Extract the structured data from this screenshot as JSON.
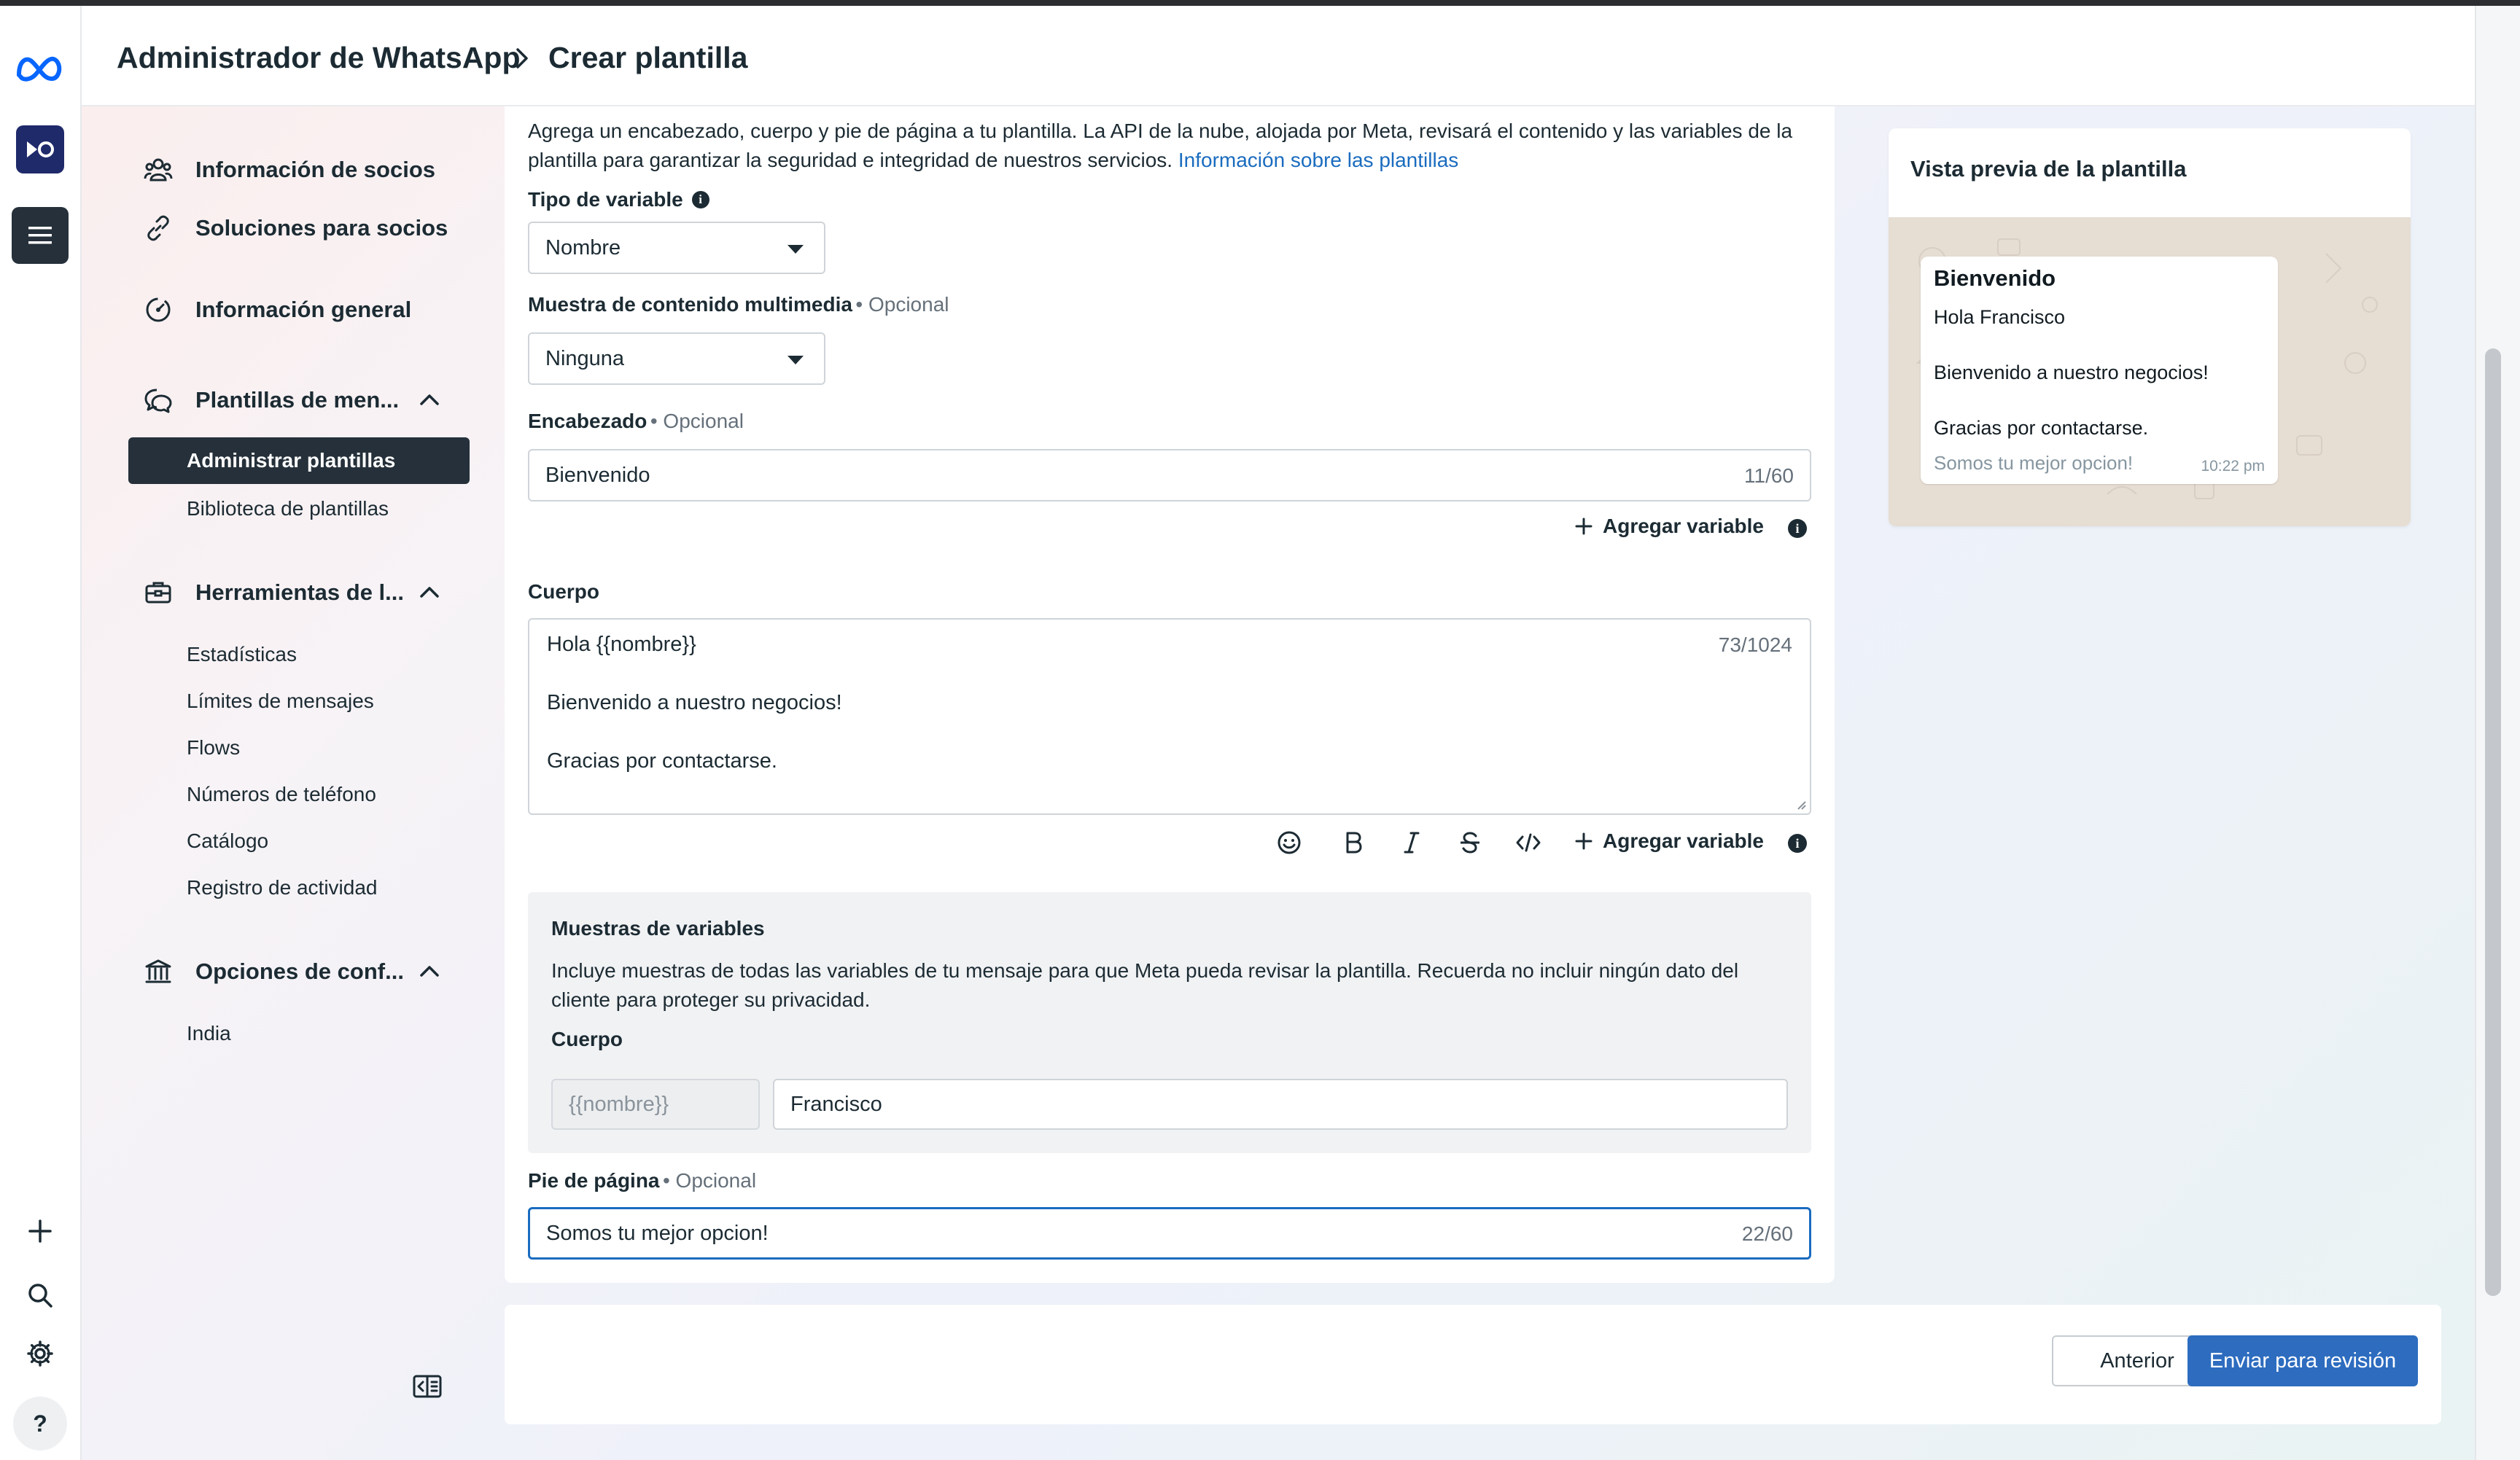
{
  "header": {
    "app_title": "Administrador de WhatsApp",
    "page_title": "Crear plantilla"
  },
  "sidebar": {
    "items": [
      {
        "label": "Información de socios",
        "icon": "partners-icon"
      },
      {
        "label": "Soluciones para socios",
        "icon": "link-icon"
      },
      {
        "label": "Información general",
        "icon": "overview-icon"
      },
      {
        "label": "Plantillas de men...",
        "icon": "chat-bubbles-icon"
      },
      {
        "label": "Herramientas de l...",
        "icon": "briefcase-icon"
      },
      {
        "label": "Opciones de conf...",
        "icon": "bank-icon"
      }
    ],
    "templates_sub": [
      "Administrar plantillas",
      "Biblioteca de plantillas"
    ],
    "tools_sub": [
      "Estadísticas",
      "Límites de mensajes",
      "Flows",
      "Números de teléfono",
      "Catálogo",
      "Registro de actividad"
    ],
    "settings_sub": [
      "India"
    ]
  },
  "form": {
    "intro_text": "Agrega un encabezado, cuerpo y pie de página a tu plantilla. La API de la nube, alojada por Meta, revisará el contenido y las variables de la plantilla para garantizar la seguridad e integridad de nuestros servicios.",
    "intro_link": "Información sobre las plantillas",
    "variable_type_label": "Tipo de variable",
    "variable_type_value": "Nombre",
    "media_label": "Muestra de contenido multimedia",
    "optional": "• Opcional",
    "media_value": "Ninguna",
    "header_label": "Encabezado",
    "header_value": "Bienvenido",
    "header_counter": "11/60",
    "add_variable": "Agregar variable",
    "body_label": "Cuerpo",
    "body_line1": "Hola {{nombre}}",
    "body_line2": "Bienvenido a nuestro negocios!",
    "body_line3": "Gracias por contactarse.",
    "body_counter": "73/1024",
    "samples_title": "Muestras de variables",
    "samples_text": "Incluye muestras de todas las variables de tu mensaje para que Meta pueda revisar la plantilla. Recuerda no incluir ningún dato del cliente para proteger su privacidad.",
    "samples_body_label": "Cuerpo",
    "sample_placeholder": "{{nombre}}",
    "sample_value": "Francisco",
    "footer_label": "Pie de página",
    "footer_value": "Somos tu mejor opcion!",
    "footer_counter": "22/60"
  },
  "preview": {
    "title": "Vista previa de la plantilla",
    "header": "Bienvenido",
    "line1": "Hola Francisco",
    "line2": "Bienvenido a nuestro negocios!",
    "line3": "Gracias por contactarse.",
    "footer": "Somos tu mejor opcion!",
    "time": "10:22 pm"
  },
  "buttons": {
    "previous": "Anterior",
    "submit": "Enviar para revisión"
  },
  "rail": {
    "help": "?"
  },
  "colors": {
    "primary_button": "#2d6cbf",
    "link": "#1a6cbf",
    "active_nav": "#25303a"
  }
}
